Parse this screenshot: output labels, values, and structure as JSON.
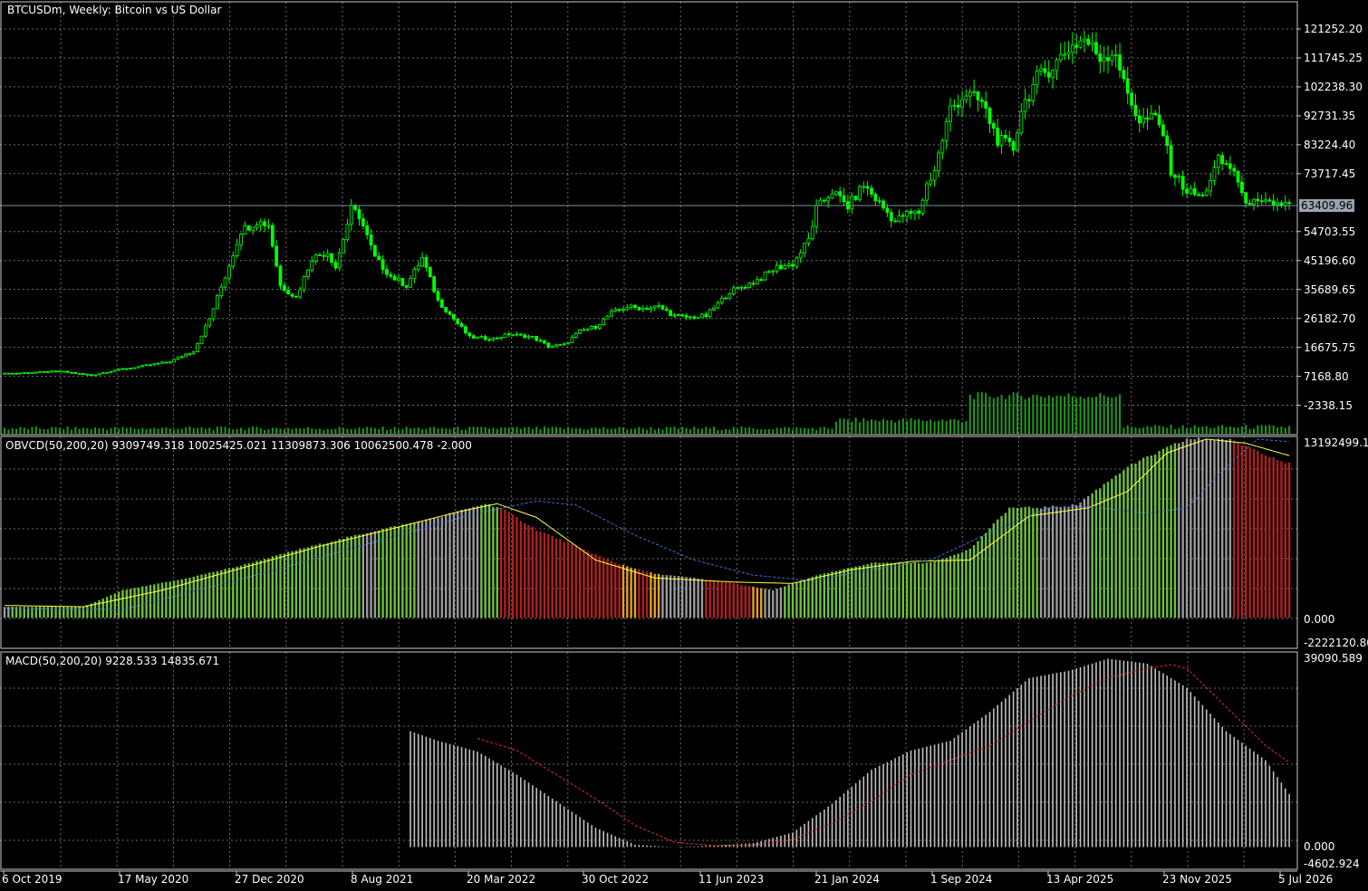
{
  "header": {
    "symbol_title": "BTCUSDm, Weekly:  Bitcoin vs US Dollar",
    "obvcd_title": "OBVCD(50,200,20) 9309749.318 10025425.021 11309873.306 10062500.478 -2.000",
    "macd_title": "MACD(50,200,20) 9228.533 14835.671"
  },
  "colors": {
    "background": "#000000",
    "grid": "#c8c8c8",
    "candle": "#00ff00",
    "volume": "#1f9a1f",
    "obv_green": "#6fbf3f",
    "obv_red": "#b02020",
    "obv_gray": "#9b9b9b",
    "obv_orange": "#e6a020",
    "obv_yellow_line": "#ffff40",
    "obv_blue_line": "#3a6fe0",
    "macd_hist": "#c0c0c0",
    "macd_signal": "#e03020",
    "price_line": "#7d8fa0"
  },
  "price_panel": {
    "current_price": "63409.96",
    "y_ticks": [
      "121252.20",
      "111745.25",
      "102238.30",
      "92731.35",
      "83224.40",
      "73717.45",
      "54703.55",
      "45196.60",
      "35689.65",
      "26182.70",
      "16675.75",
      "7168.80",
      "-2338.15"
    ]
  },
  "obvcd_panel": {
    "y_ticks": [
      "13192499.16",
      "0.000",
      "-2222120.80"
    ]
  },
  "macd_panel": {
    "y_ticks": [
      "39090.589",
      "0.000",
      "-4602.924"
    ]
  },
  "x_axis": {
    "labels": [
      "6 Oct 2019",
      "17 May 2020",
      "27 Dec 2020",
      "8 Aug 2021",
      "20 Mar 2022",
      "30 Oct 2022",
      "11 Jun 2023",
      "21 Jan 2024",
      "1 Sep 2024",
      "13 Apr 2025",
      "23 Nov 2025",
      "5 Jul 2026"
    ]
  },
  "chart_data": [
    {
      "type": "candlestick",
      "title": "BTCUSDm, Weekly:  Bitcoin vs US Dollar",
      "ylim": [
        -2338.15,
        121252.2
      ],
      "x": [
        "6 Oct 2019",
        "17 May 2020",
        "27 Dec 2020",
        "8 Aug 2021",
        "20 Mar 2022",
        "30 Oct 2022",
        "11 Jun 2023",
        "21 Jan 2024",
        "1 Sep 2024",
        "13 Apr 2025",
        "23 Nov 2025",
        "5 Jul 2026"
      ],
      "series": [
        {
          "close_keypoints": [
            [
              0,
              8000
            ],
            [
              14,
              8800
            ],
            [
              22,
              7500
            ],
            [
              28,
              9200
            ],
            [
              35,
              10500
            ],
            [
              42,
              12000
            ],
            [
              48,
              15500
            ],
            [
              52,
              26000
            ],
            [
              56,
              40000
            ],
            [
              60,
              55000
            ],
            [
              64,
              58000
            ],
            [
              67,
              57000
            ],
            [
              70,
              37000
            ],
            [
              74,
              33000
            ],
            [
              78,
              46000
            ],
            [
              82,
              48000
            ],
            [
              84,
              43000
            ],
            [
              88,
              62000
            ],
            [
              90,
              60000
            ],
            [
              94,
              46000
            ],
            [
              98,
              40000
            ],
            [
              102,
              37000
            ],
            [
              106,
              46000
            ],
            [
              110,
              32000
            ],
            [
              114,
              26000
            ],
            [
              118,
              20000
            ],
            [
              124,
              19500
            ],
            [
              128,
              21000
            ],
            [
              134,
              20000
            ],
            [
              138,
              17000
            ],
            [
              142,
              17500
            ],
            [
              146,
              22000
            ],
            [
              150,
              23500
            ],
            [
              154,
              28000
            ],
            [
              158,
              30000
            ],
            [
              162,
              29500
            ],
            [
              166,
              30000
            ],
            [
              170,
              27000
            ],
            [
              174,
              26500
            ],
            [
              178,
              27000
            ],
            [
              184,
              35000
            ],
            [
              190,
              38000
            ],
            [
              196,
              43000
            ],
            [
              200,
              44000
            ],
            [
              204,
              52000
            ],
            [
              206,
              62000
            ],
            [
              210,
              68000
            ],
            [
              214,
              63000
            ],
            [
              218,
              70000
            ],
            [
              222,
              64000
            ],
            [
              226,
              58000
            ],
            [
              228,
              60000
            ],
            [
              232,
              61000
            ],
            [
              234,
              70000
            ],
            [
              236,
              75000
            ],
            [
              240,
              95000
            ],
            [
              244,
              100000
            ],
            [
              248,
              97000
            ],
            [
              252,
              85000
            ],
            [
              256,
              82000
            ],
            [
              258,
              95000
            ],
            [
              262,
              105000
            ],
            [
              266,
              109000
            ],
            [
              270,
              115000
            ],
            [
              274,
              118000
            ],
            [
              278,
              112000
            ],
            [
              282,
              114000
            ],
            [
              284,
              103000
            ],
            [
              288,
              91000
            ],
            [
              292,
              92000
            ],
            [
              294,
              87000
            ],
            [
              296,
              75000
            ],
            [
              300,
              68000
            ],
            [
              304,
              66000
            ],
            [
              308,
              78000
            ],
            [
              312,
              75000
            ],
            [
              314,
              66000
            ],
            [
              318,
              63500
            ],
            [
              322,
              64000
            ],
            [
              326,
              63410
            ]
          ]
        }
      ]
    },
    {
      "type": "bar",
      "title": "OBVCD(50,200,20) 9309749.318 10025425.021 11309873.306 10062500.478 -2.000",
      "ylim": [
        -2222120.8,
        13192499.16
      ],
      "series": [
        {
          "values_keypoints": [
            [
              0,
              800000
            ],
            [
              20,
              800000
            ],
            [
              30,
              2000000
            ],
            [
              45,
              2800000
            ],
            [
              60,
              3800000
            ],
            [
              75,
              5000000
            ],
            [
              95,
              6400000
            ],
            [
              110,
              7300000
            ],
            [
              122,
              8300000
            ],
            [
              126,
              8000000
            ],
            [
              135,
              6400000
            ],
            [
              155,
              4000000
            ],
            [
              165,
              3200000
            ],
            [
              175,
              2900000
            ],
            [
              185,
              2500000
            ],
            [
              195,
              2000000
            ],
            [
              205,
              3000000
            ],
            [
              220,
              4000000
            ],
            [
              235,
              4000000
            ],
            [
              245,
              5000000
            ],
            [
              255,
              8000000
            ],
            [
              262,
              8000000
            ],
            [
              272,
              8200000
            ],
            [
              285,
              11000000
            ],
            [
              300,
              13000000
            ],
            [
              310,
              13000000
            ],
            [
              316,
              12400000
            ],
            [
              326,
              11200000
            ]
          ],
          "color_runs": [
            [
              0,
              1,
              "gray"
            ],
            [
              2,
              90,
              "green"
            ],
            [
              91,
              94,
              "gray"
            ],
            [
              95,
              104,
              "green"
            ],
            [
              105,
              120,
              "gray"
            ],
            [
              121,
              125,
              "green"
            ],
            [
              126,
              156,
              "red"
            ],
            [
              157,
              160,
              "orange"
            ],
            [
              161,
              163,
              "red"
            ],
            [
              164,
              166,
              "orange"
            ],
            [
              167,
              177,
              "gray"
            ],
            [
              178,
              180,
              "red"
            ],
            [
              181,
              189,
              "red"
            ],
            [
              190,
              192,
              "orange"
            ],
            [
              193,
              197,
              "gray"
            ],
            [
              198,
              227,
              "green"
            ],
            [
              228,
              262,
              "green"
            ],
            [
              263,
              275,
              "gray"
            ],
            [
              276,
              297,
              "green"
            ],
            [
              298,
              301,
              "gray"
            ],
            [
              302,
              311,
              "gray"
            ],
            [
              312,
              326,
              "red"
            ]
          ],
          "yellow_line_keypoints": [
            [
              0,
              900000
            ],
            [
              20,
              800000
            ],
            [
              40,
              2000000
            ],
            [
              60,
              3600000
            ],
            [
              80,
              5200000
            ],
            [
              100,
              6600000
            ],
            [
              115,
              7700000
            ],
            [
              125,
              8300000
            ],
            [
              135,
              7300000
            ],
            [
              150,
              4200000
            ],
            [
              165,
              2900000
            ],
            [
              185,
              2600000
            ],
            [
              200,
              2500000
            ],
            [
              215,
              3500000
            ],
            [
              230,
              4100000
            ],
            [
              245,
              4200000
            ],
            [
              260,
              7400000
            ],
            [
              275,
              8000000
            ],
            [
              285,
              9200000
            ],
            [
              295,
              12000000
            ],
            [
              305,
              13000000
            ],
            [
              315,
              12700000
            ],
            [
              326,
              11800000
            ]
          ],
          "blue_line_keypoints": [
            [
              0,
              700000
            ],
            [
              30,
              600000
            ],
            [
              60,
              2800000
            ],
            [
              80,
              4400000
            ],
            [
              100,
              6000000
            ],
            [
              120,
              7600000
            ],
            [
              135,
              8500000
            ],
            [
              145,
              8200000
            ],
            [
              160,
              6000000
            ],
            [
              175,
              4200000
            ],
            [
              190,
              3100000
            ],
            [
              205,
              2700000
            ],
            [
              220,
              3500000
            ],
            [
              235,
              4200000
            ],
            [
              250,
              6200000
            ],
            [
              265,
              8000000
            ],
            [
              275,
              8100000
            ],
            [
              290,
              7600000
            ],
            [
              300,
              8000000
            ],
            [
              310,
              11000000
            ],
            [
              318,
              13000000
            ],
            [
              326,
              12800000
            ]
          ]
        }
      ]
    },
    {
      "type": "bar",
      "title": "MACD(50,200,20) 9228.533 14835.671",
      "ylim": [
        -4602.924,
        39090.589
      ],
      "series": [
        {
          "name": "MACD",
          "start_index": 103,
          "values_keypoints": [
            [
              103,
              24000
            ],
            [
              110,
              22000
            ],
            [
              120,
              19800
            ],
            [
              130,
              15000
            ],
            [
              140,
              9500
            ],
            [
              150,
              4000
            ],
            [
              160,
              500
            ],
            [
              170,
              0
            ],
            [
              180,
              300
            ],
            [
              190,
              800
            ],
            [
              200,
              3000
            ],
            [
              210,
              9000
            ],
            [
              220,
              16000
            ],
            [
              230,
              20000
            ],
            [
              240,
              22000
            ],
            [
              250,
              28000
            ],
            [
              260,
              35000
            ],
            [
              270,
              36500
            ],
            [
              280,
              39000
            ],
            [
              290,
              38000
            ],
            [
              300,
              33000
            ],
            [
              310,
              24000
            ],
            [
              320,
              18000
            ],
            [
              326,
              11000
            ]
          ]
        },
        {
          "name": "Signal",
          "start_index": 120,
          "values_keypoints": [
            [
              120,
              22500
            ],
            [
              130,
              20000
            ],
            [
              140,
              15000
            ],
            [
              150,
              10000
            ],
            [
              160,
              4500
            ],
            [
              170,
              1000
            ],
            [
              180,
              300
            ],
            [
              190,
              400
            ],
            [
              200,
              1500
            ],
            [
              210,
              5000
            ],
            [
              220,
              9500
            ],
            [
              230,
              15000
            ],
            [
              240,
              18000
            ],
            [
              250,
              21000
            ],
            [
              260,
              26000
            ],
            [
              270,
              31000
            ],
            [
              280,
              35000
            ],
            [
              290,
              37000
            ],
            [
              296,
              37800
            ],
            [
              300,
              37000
            ],
            [
              310,
              29000
            ],
            [
              320,
              21000
            ],
            [
              326,
              17500
            ]
          ]
        }
      ]
    }
  ]
}
